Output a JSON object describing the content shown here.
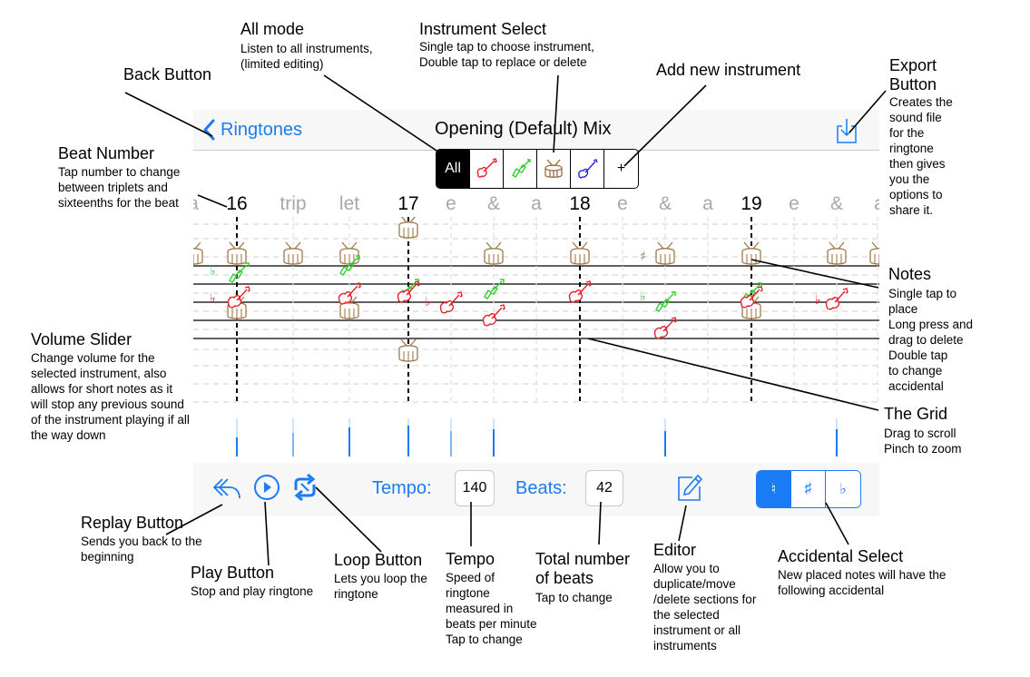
{
  "navbar": {
    "back_label": "Ringtones",
    "title": "Opening (Default) Mix"
  },
  "instrument_select": {
    "all_label": "All",
    "add_label": "+",
    "items": [
      {
        "name": "guitar-red-icon",
        "color": "#e8202a"
      },
      {
        "name": "guitar-green-icon",
        "color": "#33cc33"
      },
      {
        "name": "drum-icon",
        "color": "#a0784a"
      },
      {
        "name": "guitar-blue-icon",
        "color": "#2424d6"
      }
    ]
  },
  "beats": [
    "a",
    "16",
    "trip",
    "let",
    "17",
    "e",
    "&",
    "a",
    "18",
    "e",
    "&",
    "a",
    "19",
    "e",
    "&",
    "a"
  ],
  "toolbar": {
    "tempo_label": "Tempo:",
    "tempo_value": "140",
    "beats_label": "Beats:",
    "beats_value": "42",
    "accidentals": [
      "♮",
      "♯",
      "♭"
    ],
    "selected_accidental": "♮"
  },
  "grid_accidentals": [
    "♭",
    "♭",
    "♭",
    "♭",
    "♯",
    "♭"
  ],
  "annotations": {
    "back": {
      "title": "Back Button"
    },
    "all_mode": {
      "title": "All mode",
      "lines": [
        "Listen to all instruments,",
        "(limited editing)"
      ]
    },
    "instr": {
      "title": "Instrument Select",
      "lines": [
        "Single tap to choose instrument,",
        "Double tap to replace or delete"
      ]
    },
    "add": {
      "title": "Add new instrument"
    },
    "export": {
      "title_lines": [
        "Export",
        "Button"
      ],
      "lines": [
        "Creates the",
        "sound file",
        "for the",
        "ringtone",
        "then gives",
        "you the",
        "options to",
        "share it."
      ]
    },
    "beat": {
      "title": "Beat Number",
      "lines": [
        "Tap number to change",
        "between triplets and",
        "sixteenths for the beat"
      ]
    },
    "notes": {
      "title": "Notes",
      "lines": [
        "Single tap to",
        "place",
        "Long press and",
        "drag to delete",
        "Double tap",
        "to change",
        "accidental"
      ]
    },
    "volume": {
      "title": "Volume Slider",
      "lines": [
        "Change volume for the",
        "selected instrument, also",
        "allows for short notes as it",
        "will stop any previous sound",
        "of the instrument playing if all",
        "the way down"
      ]
    },
    "grid": {
      "title": "The Grid",
      "lines": [
        "Drag to scroll",
        "Pinch to zoom"
      ]
    },
    "replay": {
      "title": "Replay Button",
      "lines": [
        "Sends you back to the",
        "beginning"
      ]
    },
    "play": {
      "title": "Play Button",
      "lines": [
        "Stop and play ringtone"
      ]
    },
    "loop": {
      "title": "Loop Button",
      "lines": [
        "Lets you loop the",
        "ringtone"
      ]
    },
    "tempo": {
      "title": "Tempo",
      "lines": [
        "Speed of",
        "ringtone",
        "measured in",
        "beats per minute",
        "Tap to change"
      ]
    },
    "total": {
      "title_lines": [
        "Total number",
        "of beats"
      ],
      "lines": [
        "Tap to change"
      ]
    },
    "editor": {
      "title": "Editor",
      "lines": [
        "Allow you to",
        "duplicate/move",
        "/delete sections for",
        "the selected",
        "instrument or all",
        "instruments"
      ]
    },
    "accsel": {
      "title": "Accidental Select",
      "lines": [
        "New placed notes will have the",
        "following accidental"
      ]
    }
  },
  "colors": {
    "accent": "#1a7cf4",
    "guitar_red": "#e8202a",
    "guitar_green": "#33cc33",
    "drum": "#a0784a",
    "guitar_blue": "#2424d6"
  }
}
